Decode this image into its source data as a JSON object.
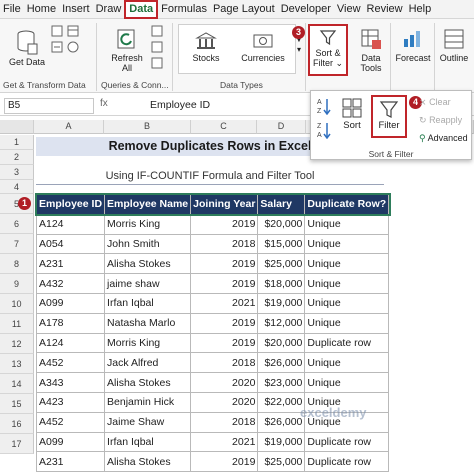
{
  "ribbon_tabs": [
    "File",
    "Home",
    "Insert",
    "Draw",
    "Data",
    "Formulas",
    "Page Layout",
    "Developer",
    "View",
    "Review",
    "Help"
  ],
  "active_tab": "Data",
  "groups": {
    "get_transform": {
      "get_data": "Get Data",
      "label": "Get & Transform Data"
    },
    "queries": {
      "refresh_all": "Refresh All",
      "label": "Queries & Conn..."
    },
    "data_types": {
      "stocks": "Stocks",
      "currencies": "Currencies",
      "label": "Data Types"
    },
    "sort_filter": {
      "label": "Sort & Filter"
    },
    "data_tools": "Data Tools",
    "forecast": "Forecast",
    "outline": "Outline"
  },
  "popup": {
    "sort": "Sort",
    "filter": "Filter",
    "clear": "Clear",
    "reapply": "Reapply",
    "advanced": "Advanced",
    "label": "Sort & Filter"
  },
  "badges": [
    "1",
    "2",
    "3",
    "4"
  ],
  "formula_bar": {
    "name_box": "B5",
    "fx": "fx",
    "content": "Employee ID"
  },
  "columns": [
    "A",
    "B",
    "C",
    "D",
    "E",
    "F"
  ],
  "rows": [
    "1",
    "2",
    "3",
    "4",
    "5",
    "6",
    "7",
    "8",
    "9",
    "10",
    "11",
    "12",
    "13",
    "14",
    "15",
    "16",
    "17",
    "18",
    "19"
  ],
  "sheet": {
    "title": "Remove Duplicates  Rows in Excel",
    "subtitle": "Using IF-COUNTIF Formula and Filter Tool",
    "headers": [
      "Employee ID",
      "Employee Name",
      "Joining Year",
      "Salary",
      "Duplicate Row?"
    ],
    "data": [
      [
        "A124",
        "Morris King",
        "2019",
        "$20,000",
        "Unique"
      ],
      [
        "A054",
        "John Smith",
        "2018",
        "$15,000",
        "Unique"
      ],
      [
        "A231",
        "Alisha Stokes",
        "2019",
        "$25,000",
        "Unique"
      ],
      [
        "A432",
        "jaime shaw",
        "2019",
        "$18,000",
        "Unique"
      ],
      [
        "A099",
        "Irfan Iqbal",
        "2021",
        "$19,000",
        "Unique"
      ],
      [
        "A178",
        "Natasha Marlo",
        "2019",
        "$12,000",
        "Unique"
      ],
      [
        "A124",
        "Morris King",
        "2019",
        "$20,000",
        "Duplicate row"
      ],
      [
        "A452",
        "Jack Alfred",
        "2018",
        "$26,000",
        "Unique"
      ],
      [
        "A343",
        "Alisha Stokes",
        "2020",
        "$23,000",
        "Unique"
      ],
      [
        "A423",
        "Benjamin Hick",
        "2020",
        "$22,000",
        "Unique"
      ],
      [
        "A452",
        "Jaime Shaw",
        "2018",
        "$26,000",
        "Unique"
      ],
      [
        "A099",
        "Irfan Iqbal",
        "2021",
        "$19,000",
        "Duplicate row"
      ],
      [
        "A231",
        "Alisha Stokes",
        "2019",
        "$25,000",
        "Duplicate row"
      ]
    ]
  },
  "watermark": "exceldemy"
}
